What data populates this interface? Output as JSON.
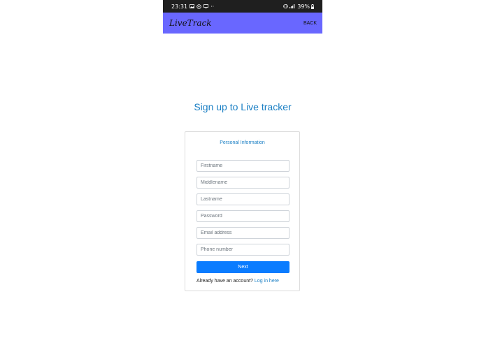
{
  "status_bar": {
    "time": "23:31",
    "battery": "39%",
    "icons": [
      "image-icon",
      "whatsapp-icon",
      "screen-icon",
      "more-dots-icon",
      "vibrate-icon",
      "signal-icon",
      "battery-icon"
    ]
  },
  "app_bar": {
    "title": "LiveTrack",
    "back_label": "Back",
    "color": "#6967ff"
  },
  "heading": "Sign up to Live tracker",
  "card": {
    "title": "Personal Information",
    "fields": {
      "firstname": {
        "placeholder": "Firstname",
        "value": ""
      },
      "middlename": {
        "placeholder": "Middlename",
        "value": ""
      },
      "lastname": {
        "placeholder": "Lastname",
        "value": ""
      },
      "password": {
        "placeholder": "Password",
        "value": ""
      },
      "email": {
        "placeholder": "Email address",
        "value": ""
      },
      "phone": {
        "placeholder": "Phone number",
        "value": ""
      }
    },
    "next_label": "Next",
    "account_prompt": "Already have an account?",
    "login_link": "Log in here"
  },
  "colors": {
    "accent": "#1a7fc4",
    "button": "#0a7cff",
    "status_bar": "#1f1f1f"
  }
}
